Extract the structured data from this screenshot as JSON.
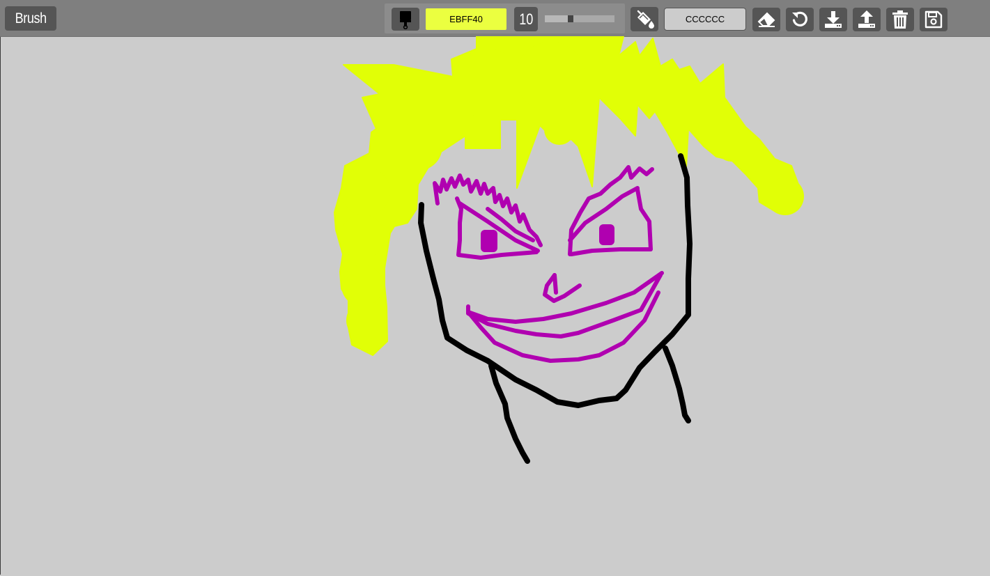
{
  "toolbar": {
    "mode_label": "Brush",
    "brush_color": "EBFF40",
    "brush_color_hex": "#ebff40",
    "brush_size": "10",
    "brush_size_value": 10,
    "brush_size_min": 1,
    "brush_size_max": 50,
    "background_color": "CCCCCC",
    "background_color_hex": "#cccccc",
    "icons": {
      "brush": "paint-brush-icon",
      "fill": "fill-bucket-icon",
      "eraser": "eraser-icon",
      "undo": "undo-icon",
      "download": "download-icon",
      "upload": "upload-icon",
      "trash": "trash-icon",
      "save": "save-icon"
    }
  },
  "canvas": {
    "stroke_colors": {
      "hair": "#e1ff06",
      "outline": "#000000",
      "face": "#b000b0"
    }
  }
}
